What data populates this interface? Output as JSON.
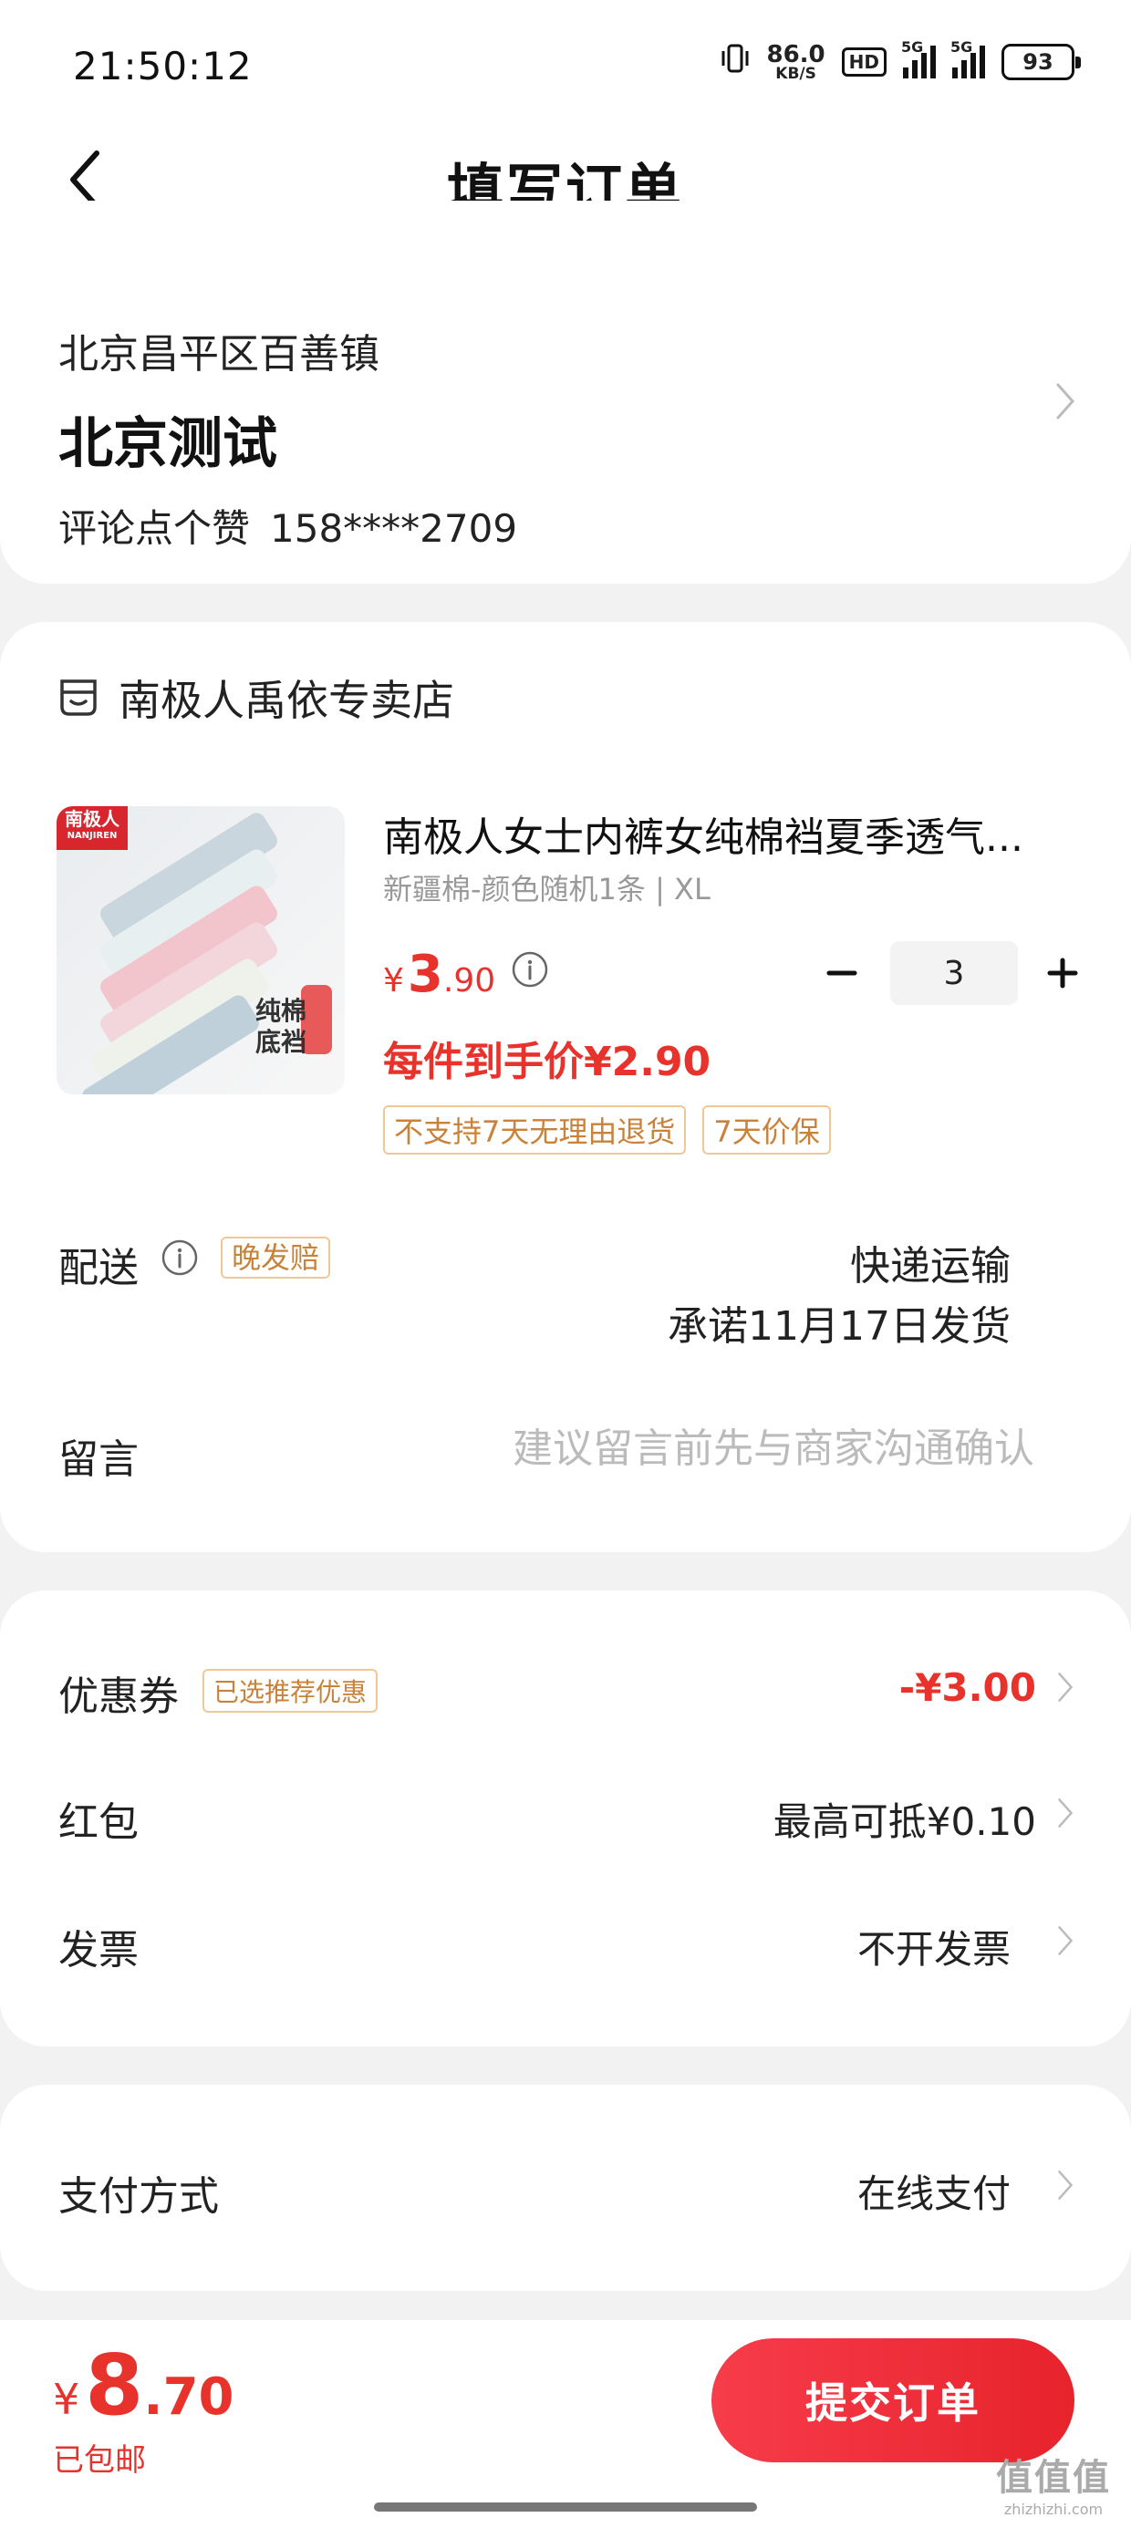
{
  "status_bar": {
    "time": "21:50:12",
    "net_speed": "86.0",
    "net_unit": "KB/S",
    "hd": "HD",
    "sig1_label": "5G",
    "sig2_label": "5G",
    "battery": "93"
  },
  "nav": {
    "title": "填写订单"
  },
  "address": {
    "region": "北京昌平区百善镇",
    "name": "北京测试",
    "contact_name": "评论点个赞",
    "phone": "158****2709"
  },
  "store": {
    "name": "南极人禹依专卖店"
  },
  "product": {
    "image_brand": "南极人",
    "image_brand_en": "NANJIREN",
    "image_text": "纯棉\n底裆",
    "title": "南极人女士内裤女纯棉裆夏季透气...",
    "spec": "新疆棉-颜色随机1条 | XL",
    "price_currency": "¥",
    "price_int": "3",
    "price_dec": ".90",
    "quantity": "3",
    "unit_price": "每件到手价¥2.90",
    "tags": [
      "不支持7天无理由退货",
      "7天价保"
    ]
  },
  "shipping": {
    "label": "配送",
    "late_tag": "晚发赔",
    "method": "快递运输",
    "promise": "承诺11月17日发货"
  },
  "message": {
    "label": "留言",
    "placeholder": "建议留言前先与商家沟通确认",
    "value": ""
  },
  "promo": {
    "coupon_label": "优惠券",
    "coupon_tag": "已选推荐优惠",
    "coupon_value": "-¥3.00",
    "redpacket_label": "红包",
    "redpacket_value": "最高可抵¥0.10",
    "invoice_label": "发票",
    "invoice_value": "不开发票"
  },
  "payment": {
    "label": "支付方式",
    "value": "在线支付"
  },
  "bottom": {
    "currency": "¥",
    "total_int": "8",
    "total_dec": ".70",
    "free_shipping": "已包邮",
    "submit_label": "提交订单"
  },
  "watermark": {
    "line1": "值值值",
    "line2": "zhizhizhi.com"
  },
  "colors": {
    "accent_red": "#e8332c",
    "tag_border": "#f0c896",
    "tag_text": "#c9823a"
  }
}
